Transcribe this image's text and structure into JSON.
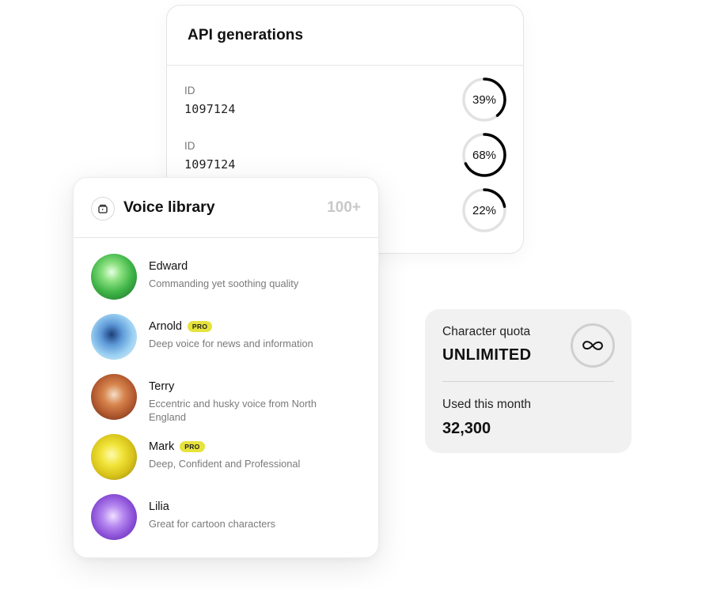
{
  "api_generations": {
    "title": "API generations",
    "rows": [
      {
        "id_label": "ID",
        "id_value": "1097124",
        "progress_label": "39%",
        "progress": 0.39
      },
      {
        "id_label": "ID",
        "id_value": "1097124",
        "progress_label": "68%",
        "progress": 0.68
      },
      {
        "progress_label": "22%",
        "progress": 0.22
      }
    ]
  },
  "voice_library": {
    "icon": "library-icon",
    "title": "Voice library",
    "count": "100+",
    "voices": [
      {
        "name": "Edward",
        "pro": false,
        "description": "Commanding yet soothing quality"
      },
      {
        "name": "Arnold",
        "pro": true,
        "badge": "PRO",
        "description": "Deep voice for news and information"
      },
      {
        "name": "Terry",
        "pro": false,
        "description": "Eccentric and husky voice from North England"
      },
      {
        "name": "Mark",
        "pro": true,
        "badge": "PRO",
        "description": "Deep, Confident and Professional"
      },
      {
        "name": "Lilia",
        "pro": false,
        "description": "Great for cartoon characters"
      }
    ]
  },
  "quota": {
    "label": "Character quota",
    "value": "UNLIMITED",
    "icon": "infinity-icon",
    "used_label": "Used this month",
    "used_value": "32,300"
  },
  "colors": {
    "ring_track": "#e2e2e2",
    "ring_fill": "#000000",
    "pro_badge": "#e6e33d",
    "quota_bg": "#f1f1f1"
  }
}
